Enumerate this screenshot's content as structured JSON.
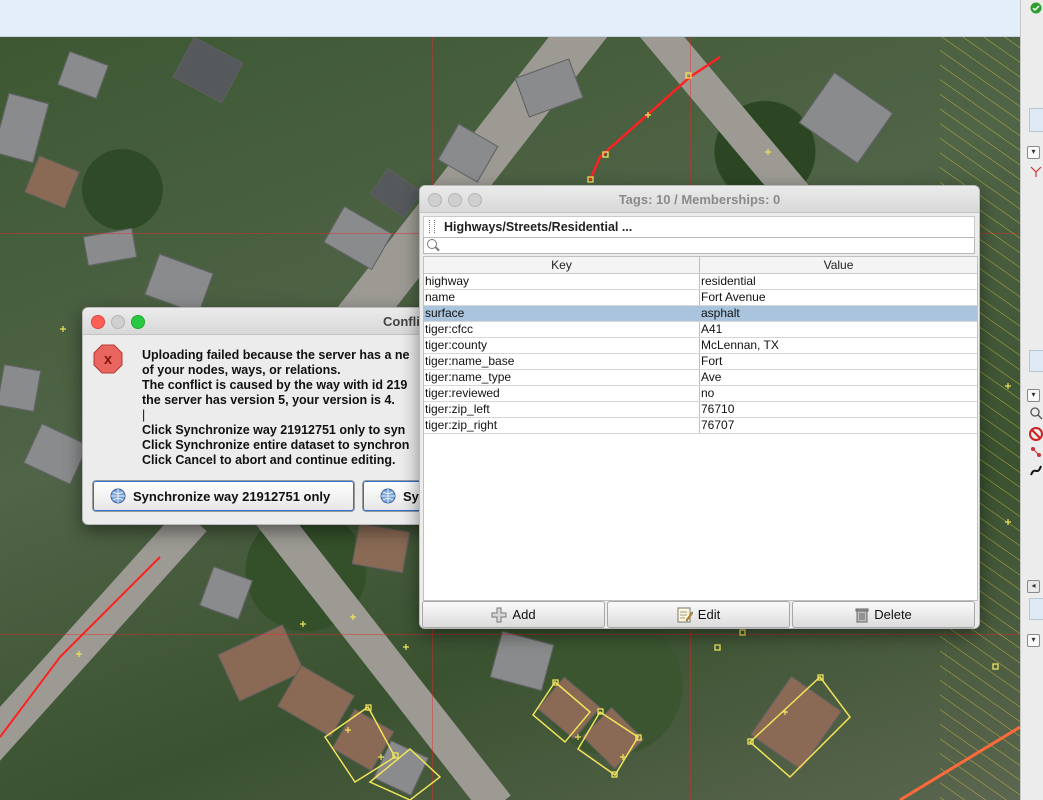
{
  "tags_window": {
    "title": "Tags: 10 / Memberships: 0",
    "preset": "Highways/Streets/Residential ...",
    "search_placeholder": "",
    "columns": [
      "Key",
      "Value"
    ],
    "rows": [
      {
        "key": "highway",
        "value": "residential"
      },
      {
        "key": "name",
        "value": "Fort Avenue"
      },
      {
        "key": "surface",
        "value": "asphalt"
      },
      {
        "key": "tiger:cfcc",
        "value": "A41"
      },
      {
        "key": "tiger:county",
        "value": "McLennan, TX"
      },
      {
        "key": "tiger:name_base",
        "value": "Fort"
      },
      {
        "key": "tiger:name_type",
        "value": "Ave"
      },
      {
        "key": "tiger:reviewed",
        "value": "no"
      },
      {
        "key": "tiger:zip_left",
        "value": "76710"
      },
      {
        "key": "tiger:zip_right",
        "value": "76707"
      }
    ],
    "selected_row": 2,
    "buttons": {
      "add": "Add",
      "edit": "Edit",
      "delete": "Delete"
    }
  },
  "conflict_dialog": {
    "title": "Confli",
    "icon": "error-x-icon",
    "lines": [
      "Uploading failed because the server has a ne",
      "of your nodes, ways, or relations.",
      "The conflict is caused by the way with id 219",
      "the server has version 5, your version is 4."
    ],
    "cursor_line": "|",
    "instructions": [
      "Click Synchronize way 21912751 only to syn",
      "Click Synchronize entire dataset to synchron",
      "Click Cancel to abort and continue editing."
    ],
    "buttons": {
      "sync_way": "Synchronize way 21912751 only",
      "sync_all": "Sy"
    }
  },
  "colors": {
    "selection": "#a9c4dc",
    "close": "#fe5f57",
    "minimize": "#febc2e",
    "zoom": "#28c840",
    "error_red": "#d9322f"
  }
}
